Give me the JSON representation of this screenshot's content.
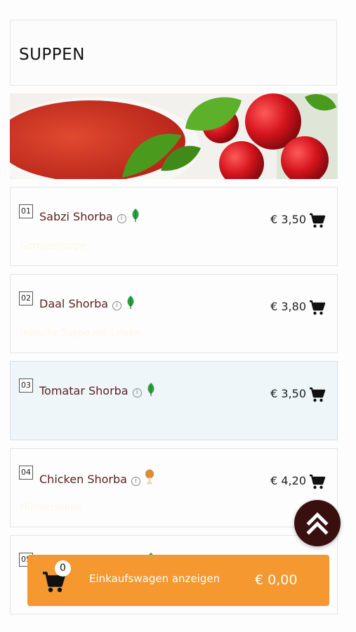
{
  "section": {
    "title": "SUPPEN"
  },
  "items": [
    {
      "number": "01",
      "name": "Sabzi Shorba",
      "price": "€ 3,50",
      "diet": "veg-leaf-icon",
      "description": "Gemüsesuppe"
    },
    {
      "number": "02",
      "name": "Daal Shorba",
      "price": "€ 3,80",
      "diet": "veg-leaf-icon",
      "description": "Indische Suppe mit Linsen"
    },
    {
      "number": "03",
      "name": "Tomatar Shorba",
      "price": "€ 3,50",
      "diet": "veg-leaf-icon",
      "description": ""
    },
    {
      "number": "04",
      "name": "Chicken Shorba",
      "price": "€ 4,20",
      "diet": "chicken-leg-icon",
      "description": "Hühnersuppe"
    },
    {
      "number": "05",
      "name": "",
      "price": "",
      "diet": "veg-leaf-icon",
      "description": ""
    }
  ],
  "cart": {
    "count": "0",
    "label": "Einkaufswagen anzeigen",
    "total": "€ 0,00"
  },
  "colors": {
    "accent": "#f4982f",
    "dark": "#3a0f10",
    "itemName": "#5a1f22",
    "veg": "#2ea043"
  }
}
